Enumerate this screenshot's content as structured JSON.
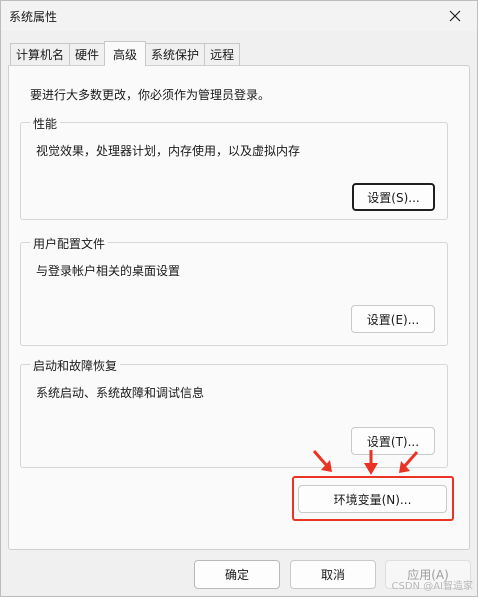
{
  "window": {
    "title": "系统属性",
    "close_icon": "close-icon"
  },
  "tabs": [
    {
      "label": "计算机名",
      "active": false
    },
    {
      "label": "硬件",
      "active": false
    },
    {
      "label": "高级",
      "active": true
    },
    {
      "label": "系统保护",
      "active": false
    },
    {
      "label": "远程",
      "active": false
    }
  ],
  "advanced": {
    "admin_note": "要进行大多数更改，你必须作为管理员登录。",
    "performance": {
      "title": "性能",
      "description": "视觉效果，处理器计划，内存使用，以及虚拟内存",
      "button_label": "设置(S)..."
    },
    "user_profiles": {
      "title": "用户配置文件",
      "description": "与登录帐户相关的桌面设置",
      "button_label": "设置(E)..."
    },
    "startup_recovery": {
      "title": "启动和故障恢复",
      "description": "系统启动、系统故障和调试信息",
      "button_label": "设置(T)..."
    },
    "env_vars_button": "环境变量(N)..."
  },
  "footer": {
    "ok_label": "确定",
    "cancel_label": "取消",
    "apply_label": "应用(A)"
  },
  "annotation": {
    "highlight_color": "#ea3323"
  },
  "watermark": "CSDN @AI智造家"
}
